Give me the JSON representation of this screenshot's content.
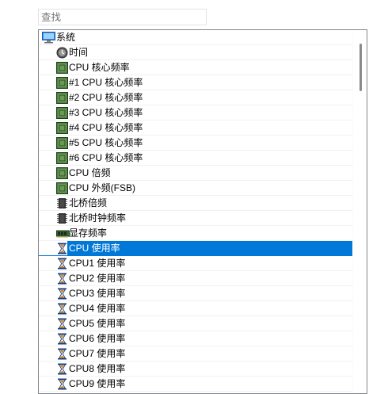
{
  "search": {
    "placeholder": "查找"
  },
  "tree": {
    "root": {
      "label": "系统",
      "icon": "computer-monitor-icon"
    },
    "items": [
      {
        "label": "时间",
        "icon": "clock-icon"
      },
      {
        "label": "CPU 核心频率",
        "icon": "cpu-chip-icon"
      },
      {
        "label": "#1 CPU 核心频率",
        "icon": "cpu-chip-icon"
      },
      {
        "label": "#2 CPU 核心频率",
        "icon": "cpu-chip-icon"
      },
      {
        "label": "#3 CPU 核心频率",
        "icon": "cpu-chip-icon"
      },
      {
        "label": "#4 CPU 核心频率",
        "icon": "cpu-chip-icon"
      },
      {
        "label": "#5 CPU 核心频率",
        "icon": "cpu-chip-icon"
      },
      {
        "label": "#6 CPU 核心频率",
        "icon": "cpu-chip-icon"
      },
      {
        "label": "CPU 倍频",
        "icon": "cpu-chip-icon"
      },
      {
        "label": "CPU 外频(FSB)",
        "icon": "cpu-chip-icon"
      },
      {
        "label": "北桥倍频",
        "icon": "northbridge-chip-icon"
      },
      {
        "label": "北桥时钟频率",
        "icon": "northbridge-chip-icon"
      },
      {
        "label": "显存频率",
        "icon": "video-memory-icon"
      },
      {
        "label": "CPU 使用率",
        "icon": "hourglass-icon",
        "selected": true
      },
      {
        "label": "CPU1 使用率",
        "icon": "hourglass-icon"
      },
      {
        "label": "CPU2 使用率",
        "icon": "hourglass-icon"
      },
      {
        "label": "CPU3 使用率",
        "icon": "hourglass-icon"
      },
      {
        "label": "CPU4 使用率",
        "icon": "hourglass-icon"
      },
      {
        "label": "CPU5 使用率",
        "icon": "hourglass-icon"
      },
      {
        "label": "CPU6 使用率",
        "icon": "hourglass-icon"
      },
      {
        "label": "CPU7 使用率",
        "icon": "hourglass-icon"
      },
      {
        "label": "CPU8 使用率",
        "icon": "hourglass-icon"
      },
      {
        "label": "CPU9 使用率",
        "icon": "hourglass-icon"
      }
    ]
  },
  "colors": {
    "selection": "#0078d7",
    "border": "#828790",
    "chip_green": "#3a6e3a",
    "hourglass_frame": "#1a3d7a",
    "hourglass_sand": "#d98a1e"
  }
}
